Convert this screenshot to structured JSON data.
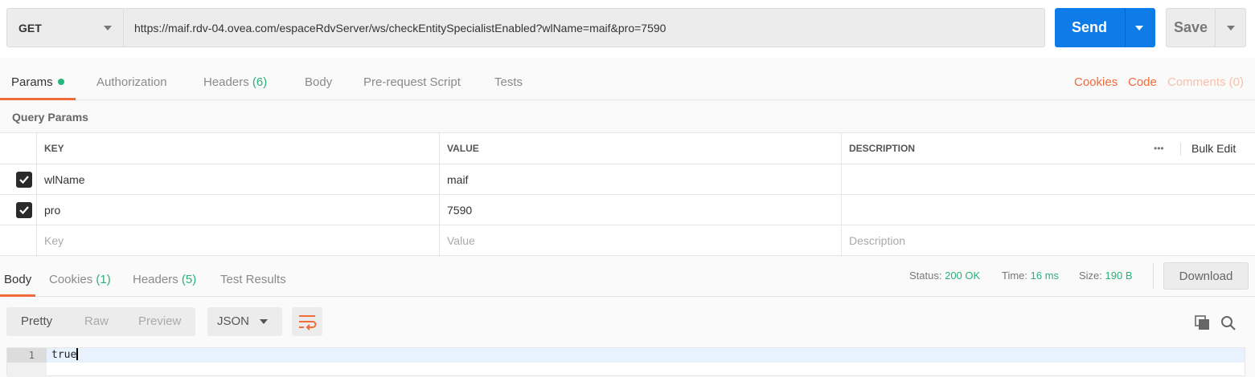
{
  "request": {
    "method": "GET",
    "url": "https://maif.rdv-04.ovea.com/espaceRdvServer/ws/checkEntitySpecialistEnabled?wlName=maif&pro=7590",
    "send_label": "Send",
    "save_label": "Save"
  },
  "request_tabs": {
    "params": "Params",
    "authorization": "Authorization",
    "headers": "Headers",
    "headers_count": "(6)",
    "body": "Body",
    "prerequest": "Pre-request Script",
    "tests": "Tests",
    "cookies": "Cookies",
    "code": "Code",
    "comments": "Comments (0)"
  },
  "query_params": {
    "title": "Query Params",
    "headers": {
      "key": "KEY",
      "value": "VALUE",
      "description": "DESCRIPTION"
    },
    "more": "•••",
    "bulk_edit": "Bulk Edit",
    "rows": [
      {
        "key": "wlName",
        "value": "maif",
        "description": ""
      },
      {
        "key": "pro",
        "value": "7590",
        "description": ""
      }
    ],
    "placeholders": {
      "key": "Key",
      "value": "Value",
      "description": "Description"
    }
  },
  "response_tabs": {
    "body": "Body",
    "cookies": "Cookies",
    "cookies_count": "(1)",
    "headers": "Headers",
    "headers_count": "(5)",
    "test_results": "Test Results"
  },
  "response_meta": {
    "status_label": "Status:",
    "status_value": "200 OK",
    "time_label": "Time:",
    "time_value": "16 ms",
    "size_label": "Size:",
    "size_value": "190 B",
    "download_label": "Download"
  },
  "format": {
    "pretty": "Pretty",
    "raw": "Raw",
    "preview": "Preview",
    "language": "JSON"
  },
  "editor": {
    "line_number": "1",
    "content": "true"
  },
  "colors": {
    "accent_orange": "#f26b3a",
    "send_blue": "#0e7ce8",
    "success_green": "#2bb07a"
  }
}
